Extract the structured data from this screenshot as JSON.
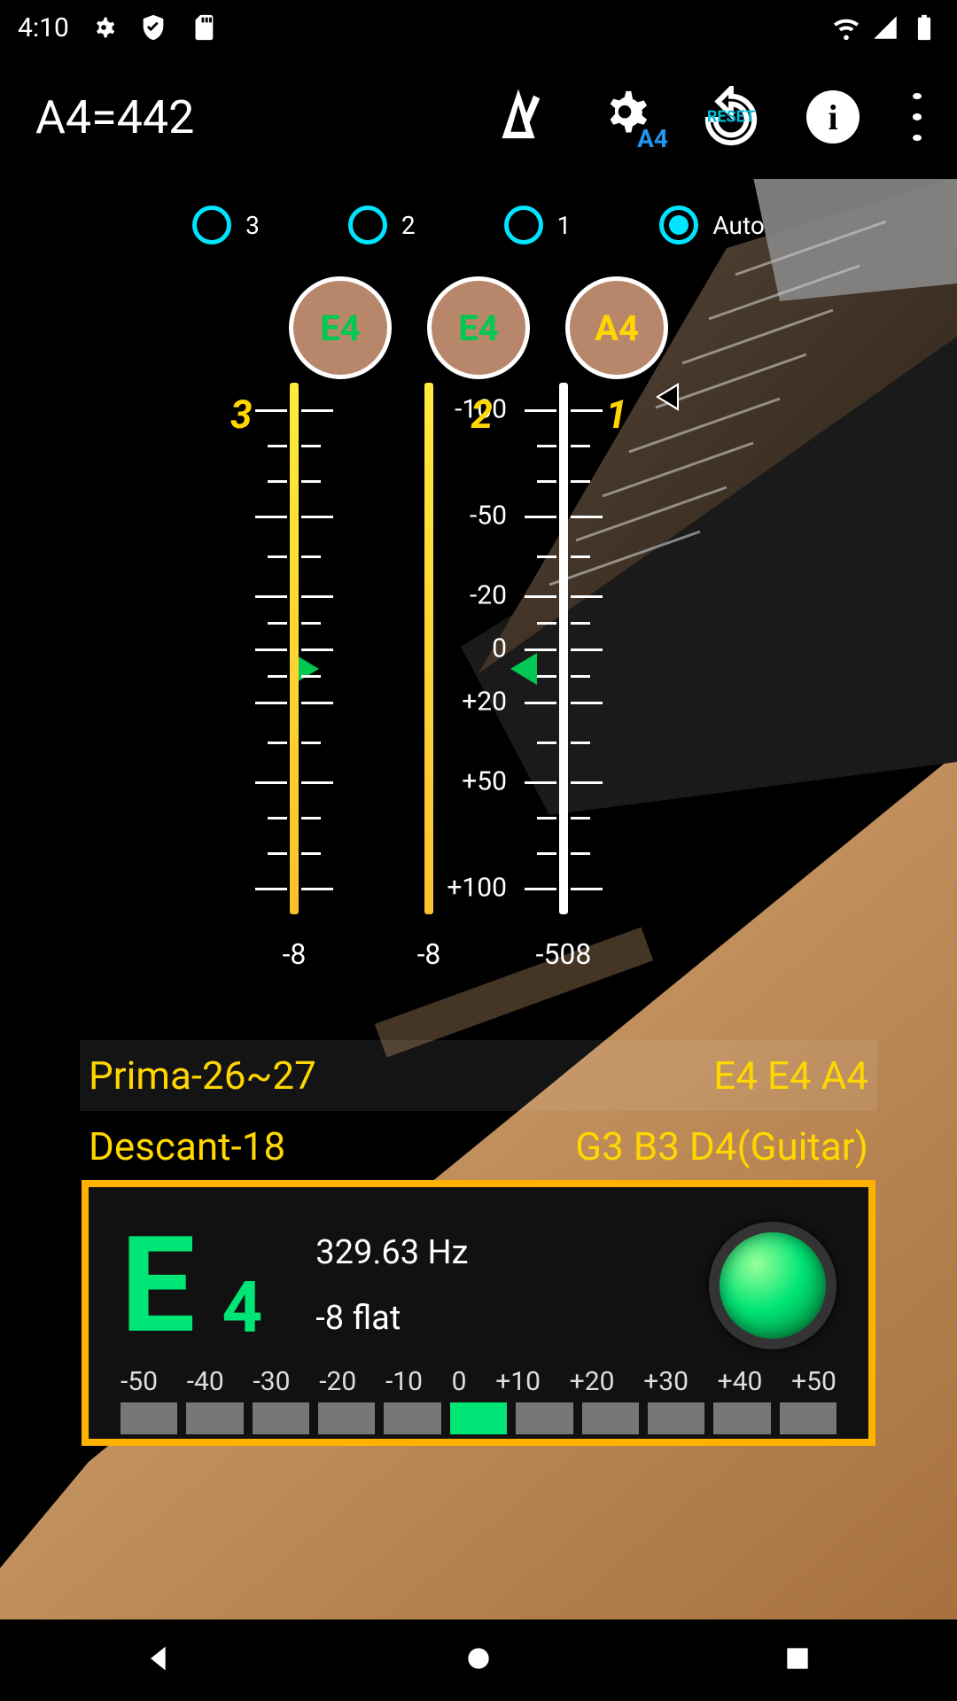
{
  "status": {
    "time": "4:10"
  },
  "appbar": {
    "title": "A4=442",
    "a4_sub": "A4",
    "reset_sub": "RESET",
    "info_label": "i"
  },
  "radios": [
    {
      "label": "3",
      "selected": false
    },
    {
      "label": "2",
      "selected": false
    },
    {
      "label": "1",
      "selected": false
    },
    {
      "label": "Auto",
      "selected": true
    }
  ],
  "pegs": [
    {
      "note": "E4",
      "color": "green"
    },
    {
      "note": "E4",
      "color": "green"
    },
    {
      "note": "A4",
      "color": "yellow"
    }
  ],
  "gauge_nums": {
    "g1": "3",
    "g2": "2",
    "g3": "1"
  },
  "gauge_bottoms": {
    "g1": "-8",
    "g2": "-8",
    "g3": "-508"
  },
  "scale": {
    "m100": "-100",
    "m50": "-50",
    "m20": "-20",
    "zero": "0",
    "p20": "+20",
    "p50": "+50",
    "p100": "+100"
  },
  "tunings": [
    {
      "name": "Prima-26~27",
      "notes": "E4 E4 A4",
      "selected": true
    },
    {
      "name": "Descant-18",
      "notes": "G3 B3 D4(Guitar)",
      "selected": false
    }
  ],
  "tuner": {
    "note_letter": "E",
    "note_octave": "4",
    "freq": "329.63 Hz",
    "cents": "-8 flat",
    "cent_labels": [
      "-50",
      "-40",
      "-30",
      "-20",
      "-10",
      "0",
      "+10",
      "+20",
      "+30",
      "+40",
      "+50"
    ],
    "active_index": 5
  }
}
